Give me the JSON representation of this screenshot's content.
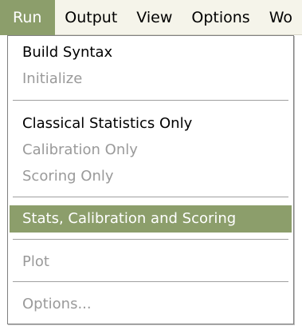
{
  "menubar": {
    "items": [
      {
        "label": "Run"
      },
      {
        "label": "Output"
      },
      {
        "label": "View"
      },
      {
        "label": "Options"
      },
      {
        "label": "Wo"
      }
    ]
  },
  "run_menu": {
    "items": [
      {
        "label": "Build Syntax",
        "state": "enabled"
      },
      {
        "label": "Initialize",
        "state": "disabled"
      },
      {
        "label": "Classical Statistics Only",
        "state": "enabled"
      },
      {
        "label": "Calibration Only",
        "state": "disabled"
      },
      {
        "label": "Scoring Only",
        "state": "disabled"
      },
      {
        "label": "Stats, Calibration and Scoring",
        "state": "highlighted"
      },
      {
        "label": "Plot",
        "state": "disabled"
      },
      {
        "label": "Options...",
        "state": "disabled"
      }
    ]
  },
  "colors": {
    "highlight": "#8c9e6b",
    "disabled_text": "#9a9a9a",
    "menubar_bg": "#f5f4ea"
  }
}
